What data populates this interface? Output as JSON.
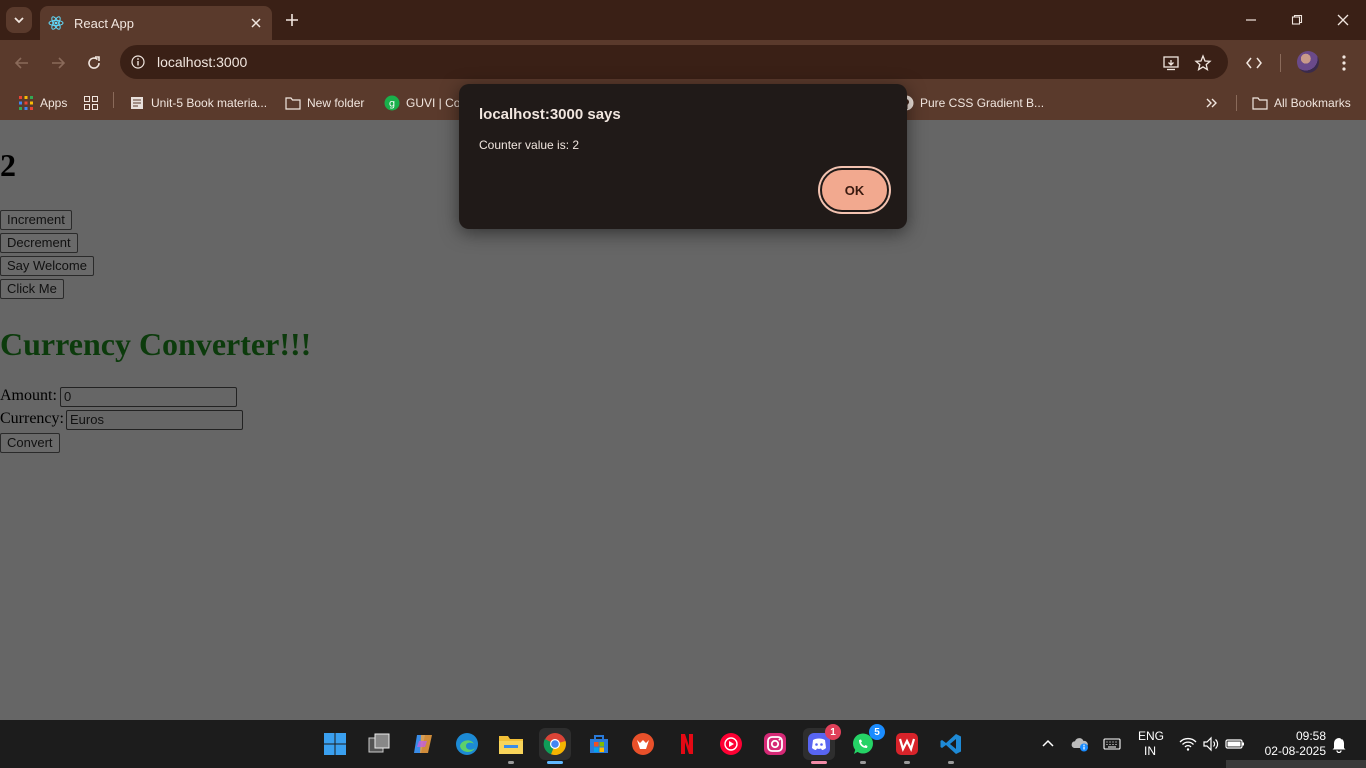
{
  "browser": {
    "tab_title": "React App",
    "url": "localhost:3000",
    "bookmarks": [
      {
        "label": "Apps"
      },
      {
        "label": "Unit-5 Book materia..."
      },
      {
        "label": "New folder"
      },
      {
        "label": "GUVI | Co"
      },
      {
        "label": "Pure CSS Gradient B..."
      }
    ],
    "all_bookmarks": "All Bookmarks"
  },
  "page": {
    "counter_value": "2",
    "buttons": {
      "increment": "Increment",
      "decrement": "Decrement",
      "say_welcome": "Say Welcome",
      "click_me": "Click Me"
    },
    "converter": {
      "title": "Currency Converter!!!",
      "amount_label": "Amount:",
      "amount_value": "0",
      "currency_label": "Currency:",
      "currency_value": "Euros",
      "convert_button": "Convert"
    }
  },
  "dialog": {
    "title": "localhost:3000 says",
    "message": "Counter value is: 2",
    "ok": "OK"
  },
  "taskbar": {
    "apps": [
      "start-icon",
      "task-view-icon",
      "copilot-icon",
      "edge-icon",
      "file-explorer-icon",
      "chrome-icon",
      "microsoft-store-icon",
      "brave-icon",
      "netflix-icon",
      "youtube-music-icon",
      "instagram-icon",
      "discord-icon",
      "whatsapp-icon",
      "wps-office-icon",
      "vscode-icon"
    ],
    "discord_badge": "1",
    "whatsapp_badge": "5",
    "lang_line1": "ENG",
    "lang_line2": "IN",
    "time": "09:58",
    "date": "02-08-2025"
  },
  "colors": {
    "chrome_dark": "#3a2016",
    "chrome_mid": "#5a3a2c",
    "page_bg": "#666666",
    "dialog_bg": "#201a18",
    "ok_button": "#f2a98f",
    "converter_title": "#0c3b0c"
  }
}
